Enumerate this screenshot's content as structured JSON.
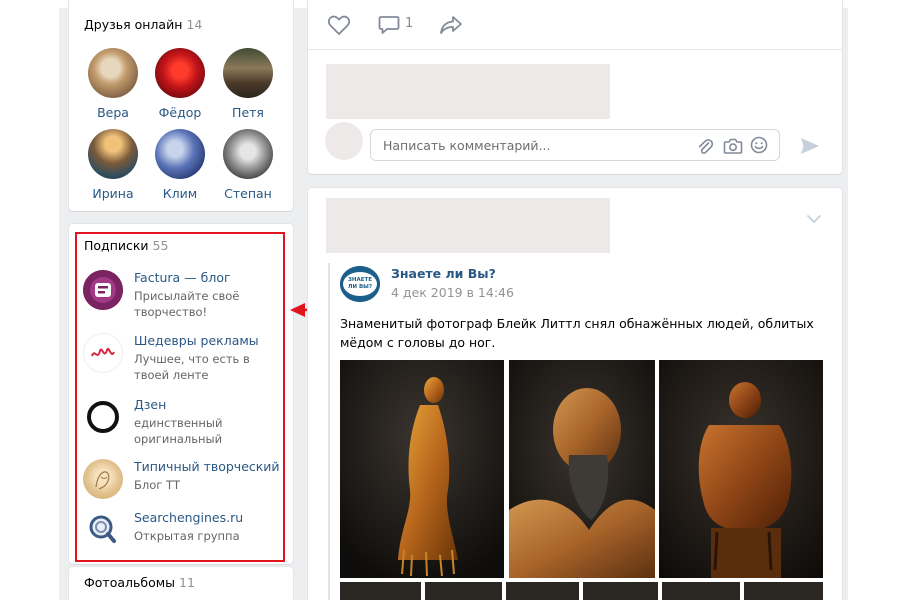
{
  "friends_online": {
    "title": "Друзья онлайн",
    "count": "14",
    "friends": [
      {
        "name": "Вера"
      },
      {
        "name": "Фёдор"
      },
      {
        "name": "Петя"
      },
      {
        "name": "Ирина"
      },
      {
        "name": "Клим"
      },
      {
        "name": "Степан"
      }
    ]
  },
  "subscriptions": {
    "title": "Подписки",
    "count": "55",
    "items": [
      {
        "name": "Factura — блог",
        "description": "Присылайте своё творчество!"
      },
      {
        "name": "Шедевры рекламы",
        "description": "Лучшее, что есть в твоей ленте"
      },
      {
        "name": "Дзен",
        "description": "единственный оригинальный"
      },
      {
        "name": "Типичный творческий",
        "description": "Блог ТТ"
      },
      {
        "name": "Searchengines.ru",
        "description": "Открытая группа"
      }
    ]
  },
  "photo_albums": {
    "title": "Фотоальбомы",
    "count": "11"
  },
  "post1": {
    "comments_count": "1",
    "comment_placeholder": "Написать комментарий..."
  },
  "post2": {
    "source_name": "Знаете ли Вы?",
    "source_logo_text": "ЗНАЕТЕ ЛИ ВЫ?",
    "date": "4 дек 2019 в 14:46",
    "text": "Знаменитый фотограф Блейк Литтл снял обнажённых людей, облитых мёдом с головы до ног."
  },
  "colors": {
    "link": "#2a5885",
    "highlight": "#e0141e",
    "page_bg": "#edeef0",
    "placeholder": "#ece9e8"
  }
}
